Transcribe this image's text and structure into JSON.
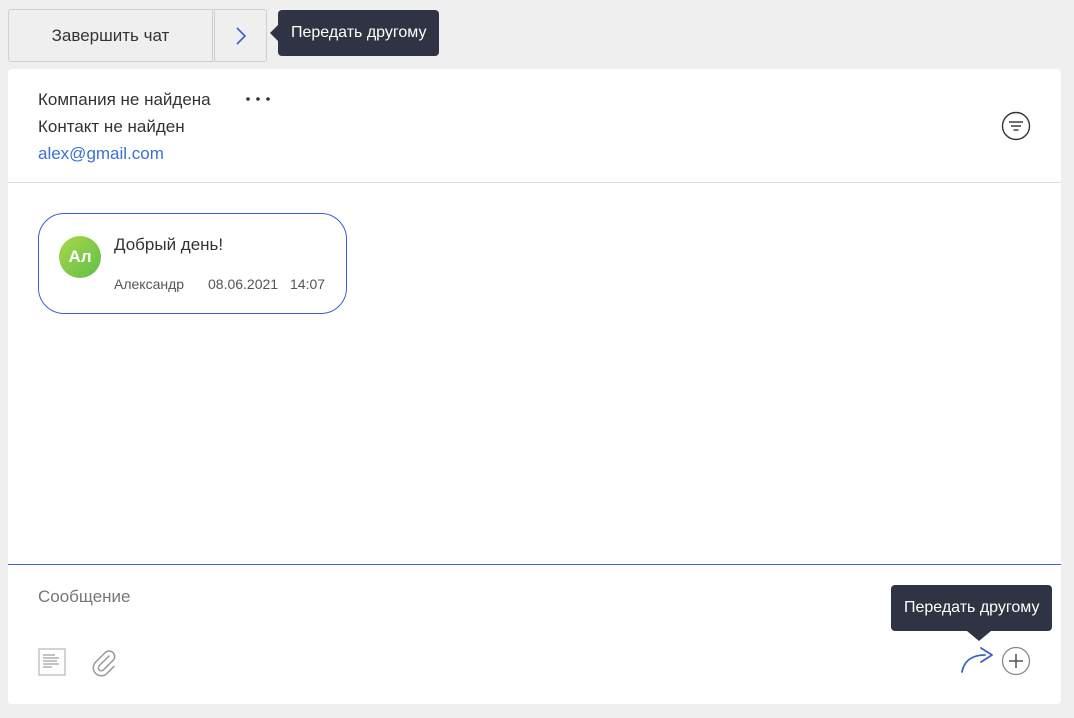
{
  "topbar": {
    "end_chat_label": "Завершить чат",
    "tooltip": "Передать другому"
  },
  "header": {
    "company": "Компания не найдена",
    "contact": "Контакт не найден",
    "email": "alex@gmail.com"
  },
  "messages": [
    {
      "avatar_initials": "Ал",
      "text": "Добрый день!",
      "author": "Александр",
      "date": "08.06.2021",
      "time": "14:07"
    }
  ],
  "composer": {
    "placeholder": "Сообщение",
    "tooltip": "Передать другому"
  },
  "colors": {
    "accent": "#3a5fd0",
    "link": "#3a6fd8",
    "tooltip_bg": "#2f3344",
    "avatar_green": "#7ccb4a"
  }
}
